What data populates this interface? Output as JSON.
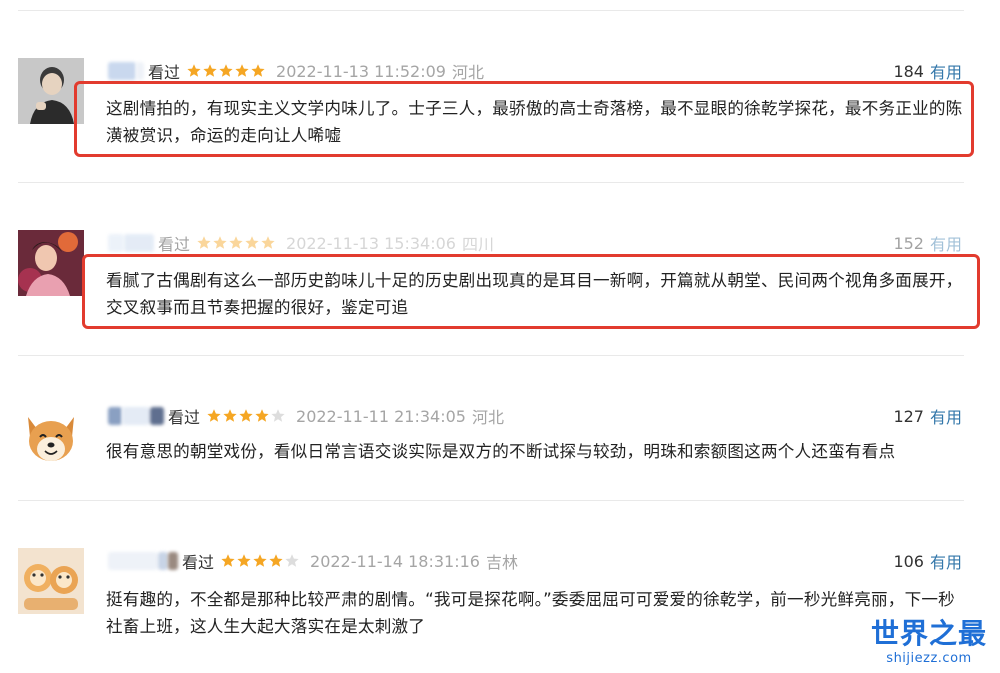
{
  "reviews": [
    {
      "watch_label": "看过",
      "rating": 5,
      "time": "2022-11-13 11:52:09",
      "location": "河北",
      "useful_count": "184",
      "useful_label": "有用",
      "text": "这剧情拍的，有现实主义文学内味儿了。士子三人，最骄傲的高士奇落榜，最不显眼的徐乾学探花，最不务正业的陈潢被赏识，命运的走向让人唏嘘",
      "highlighted": true
    },
    {
      "watch_label": "看过",
      "rating": 5,
      "time": "2022-11-13 15:34:06",
      "location": "四川",
      "useful_count": "152",
      "useful_label": "有用",
      "text": "看腻了古偶剧有这么一部历史韵味儿十足的历史剧出现真的是耳目一新啊，开篇就从朝堂、民间两个视角多面展开，交叉叙事而且节奏把握的很好，鉴定可追",
      "highlighted": true
    },
    {
      "watch_label": "看过",
      "rating": 4,
      "time": "2022-11-11 21:34:05",
      "location": "河北",
      "useful_count": "127",
      "useful_label": "有用",
      "text": "很有意思的朝堂戏份，看似日常言语交谈实际是双方的不断试探与较劲，明珠和索额图这两个人还蛮有看点",
      "highlighted": false
    },
    {
      "watch_label": "看过",
      "rating": 4,
      "time": "2022-11-14 18:31:16",
      "location": "吉林",
      "useful_count": "106",
      "useful_label": "有用",
      "text": "挺有趣的，不全都是那种比较严肃的剧情。“我可是探花啊。”委委屈屈可可爱爱的徐乾学，前一秒光鲜亮丽，下一秒社畜上班，这人生大起大落实在是太刺激了",
      "highlighted": false
    }
  ],
  "watermark": {
    "title": "世界之最",
    "url": "shijiezz.com"
  },
  "colors": {
    "star": "#f5a623",
    "star_empty": "#dddddd",
    "link": "#3377aa",
    "highlight_border": "#e23b2e",
    "meta_gray": "#a5a5a5",
    "watermark": "#1f6fd6"
  }
}
